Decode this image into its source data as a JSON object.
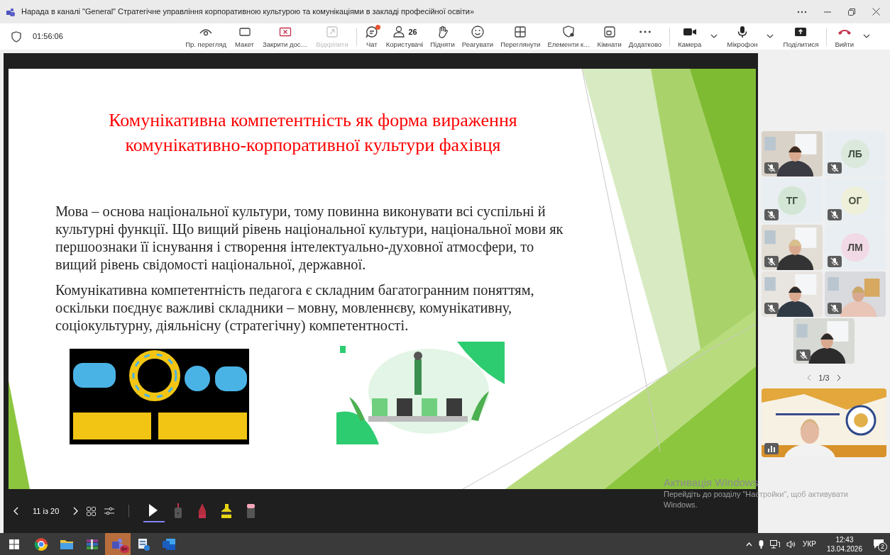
{
  "window": {
    "title": "Нарада в каналі \"General\" Стратегічне управління корпоративною культурою та комунікаціями в закладі професійної освіти»"
  },
  "meeting": {
    "timer": "01:56:06"
  },
  "toolbar": {
    "groups": [
      [
        {
          "label": "Пр. перегляд",
          "disabled": false
        },
        {
          "label": "Макет",
          "disabled": false
        },
        {
          "label": "Закрити дос…",
          "disabled": false
        },
        {
          "label": "Відкріпити",
          "disabled": true
        }
      ],
      [
        {
          "label": "Чат",
          "disabled": false,
          "unread": true
        },
        {
          "label": "Користувачі",
          "disabled": false,
          "count": "26"
        },
        {
          "label": "Підняти",
          "disabled": false
        },
        {
          "label": "Реагувати",
          "disabled": false
        },
        {
          "label": "Переглянути",
          "disabled": false
        },
        {
          "label": "Елементи к…",
          "disabled": false
        },
        {
          "label": "Кімнати",
          "disabled": false
        },
        {
          "label": "Додатково",
          "disabled": false
        }
      ],
      [
        {
          "label": "Камера",
          "disabled": false,
          "dropdown": true
        },
        {
          "label": "Мікрофон",
          "disabled": false,
          "dropdown": true
        },
        {
          "label": "Поділитися",
          "disabled": false
        }
      ],
      [
        {
          "label": "Вийти",
          "disabled": false,
          "dropdown": true
        }
      ]
    ]
  },
  "slide": {
    "title_lines": [
      "Комунікативна компетентність як форма вираження",
      "комунікативно-корпоративної культури фахівця"
    ],
    "paragraphs": [
      "Мова – основа національної культури, тому повинна виконувати всі суспільні й культурні функції. Що вищий рівень національної культури, національної мови як першоознаки її існування і створення інтелектуально-духовної атмосфери, то вищий рівень свідомості національної, державної.",
      "Комунікативна компетентність педагога є складним багатогранним поняттям, оскільки поєднує важливі складники – мовну, мовленнєву, комунікативну, соціокультурну, діяльнісну (стратегічну) компетентності."
    ]
  },
  "slide_controls": {
    "position": "11 із 20",
    "tools": [
      {
        "selected": true
      },
      {
        "selected": false
      },
      {
        "selected": false
      },
      {
        "selected": false
      },
      {
        "selected": false
      }
    ]
  },
  "participants": [
    {
      "kind": "video",
      "muted": true
    },
    {
      "kind": "avatar",
      "initials": "ЛБ",
      "color": "#dbe8dc",
      "muted": true
    },
    {
      "kind": "avatar",
      "initials": "ТГ",
      "color": "#d3e6d5",
      "muted": true
    },
    {
      "kind": "avatar",
      "initials": "ОГ",
      "color": "#eef0da",
      "muted": true
    },
    {
      "kind": "video",
      "muted": true
    },
    {
      "kind": "avatar",
      "initials": "ЛМ",
      "color": "#f1d9e6",
      "muted": true
    },
    {
      "kind": "video",
      "muted": true
    },
    {
      "kind": "video",
      "muted": true
    },
    {
      "kind": "video",
      "muted": true
    }
  ],
  "pager": "1/3",
  "presenter": {
    "muted": false
  },
  "activation": {
    "title": "Активація Windows",
    "text": "Перейдіть до розділу \"Настройки\", щоб активувати Windows."
  },
  "taskbar": {
    "apps": [
      {
        "selected": false
      },
      {
        "selected": false
      },
      {
        "selected": false
      },
      {
        "selected": true,
        "badge": "9+"
      },
      {
        "selected": false
      },
      {
        "selected": false
      }
    ],
    "tray": {
      "language": "УКР",
      "time": "12:43",
      "date": "13.04.2026",
      "notifications": "2"
    }
  }
}
